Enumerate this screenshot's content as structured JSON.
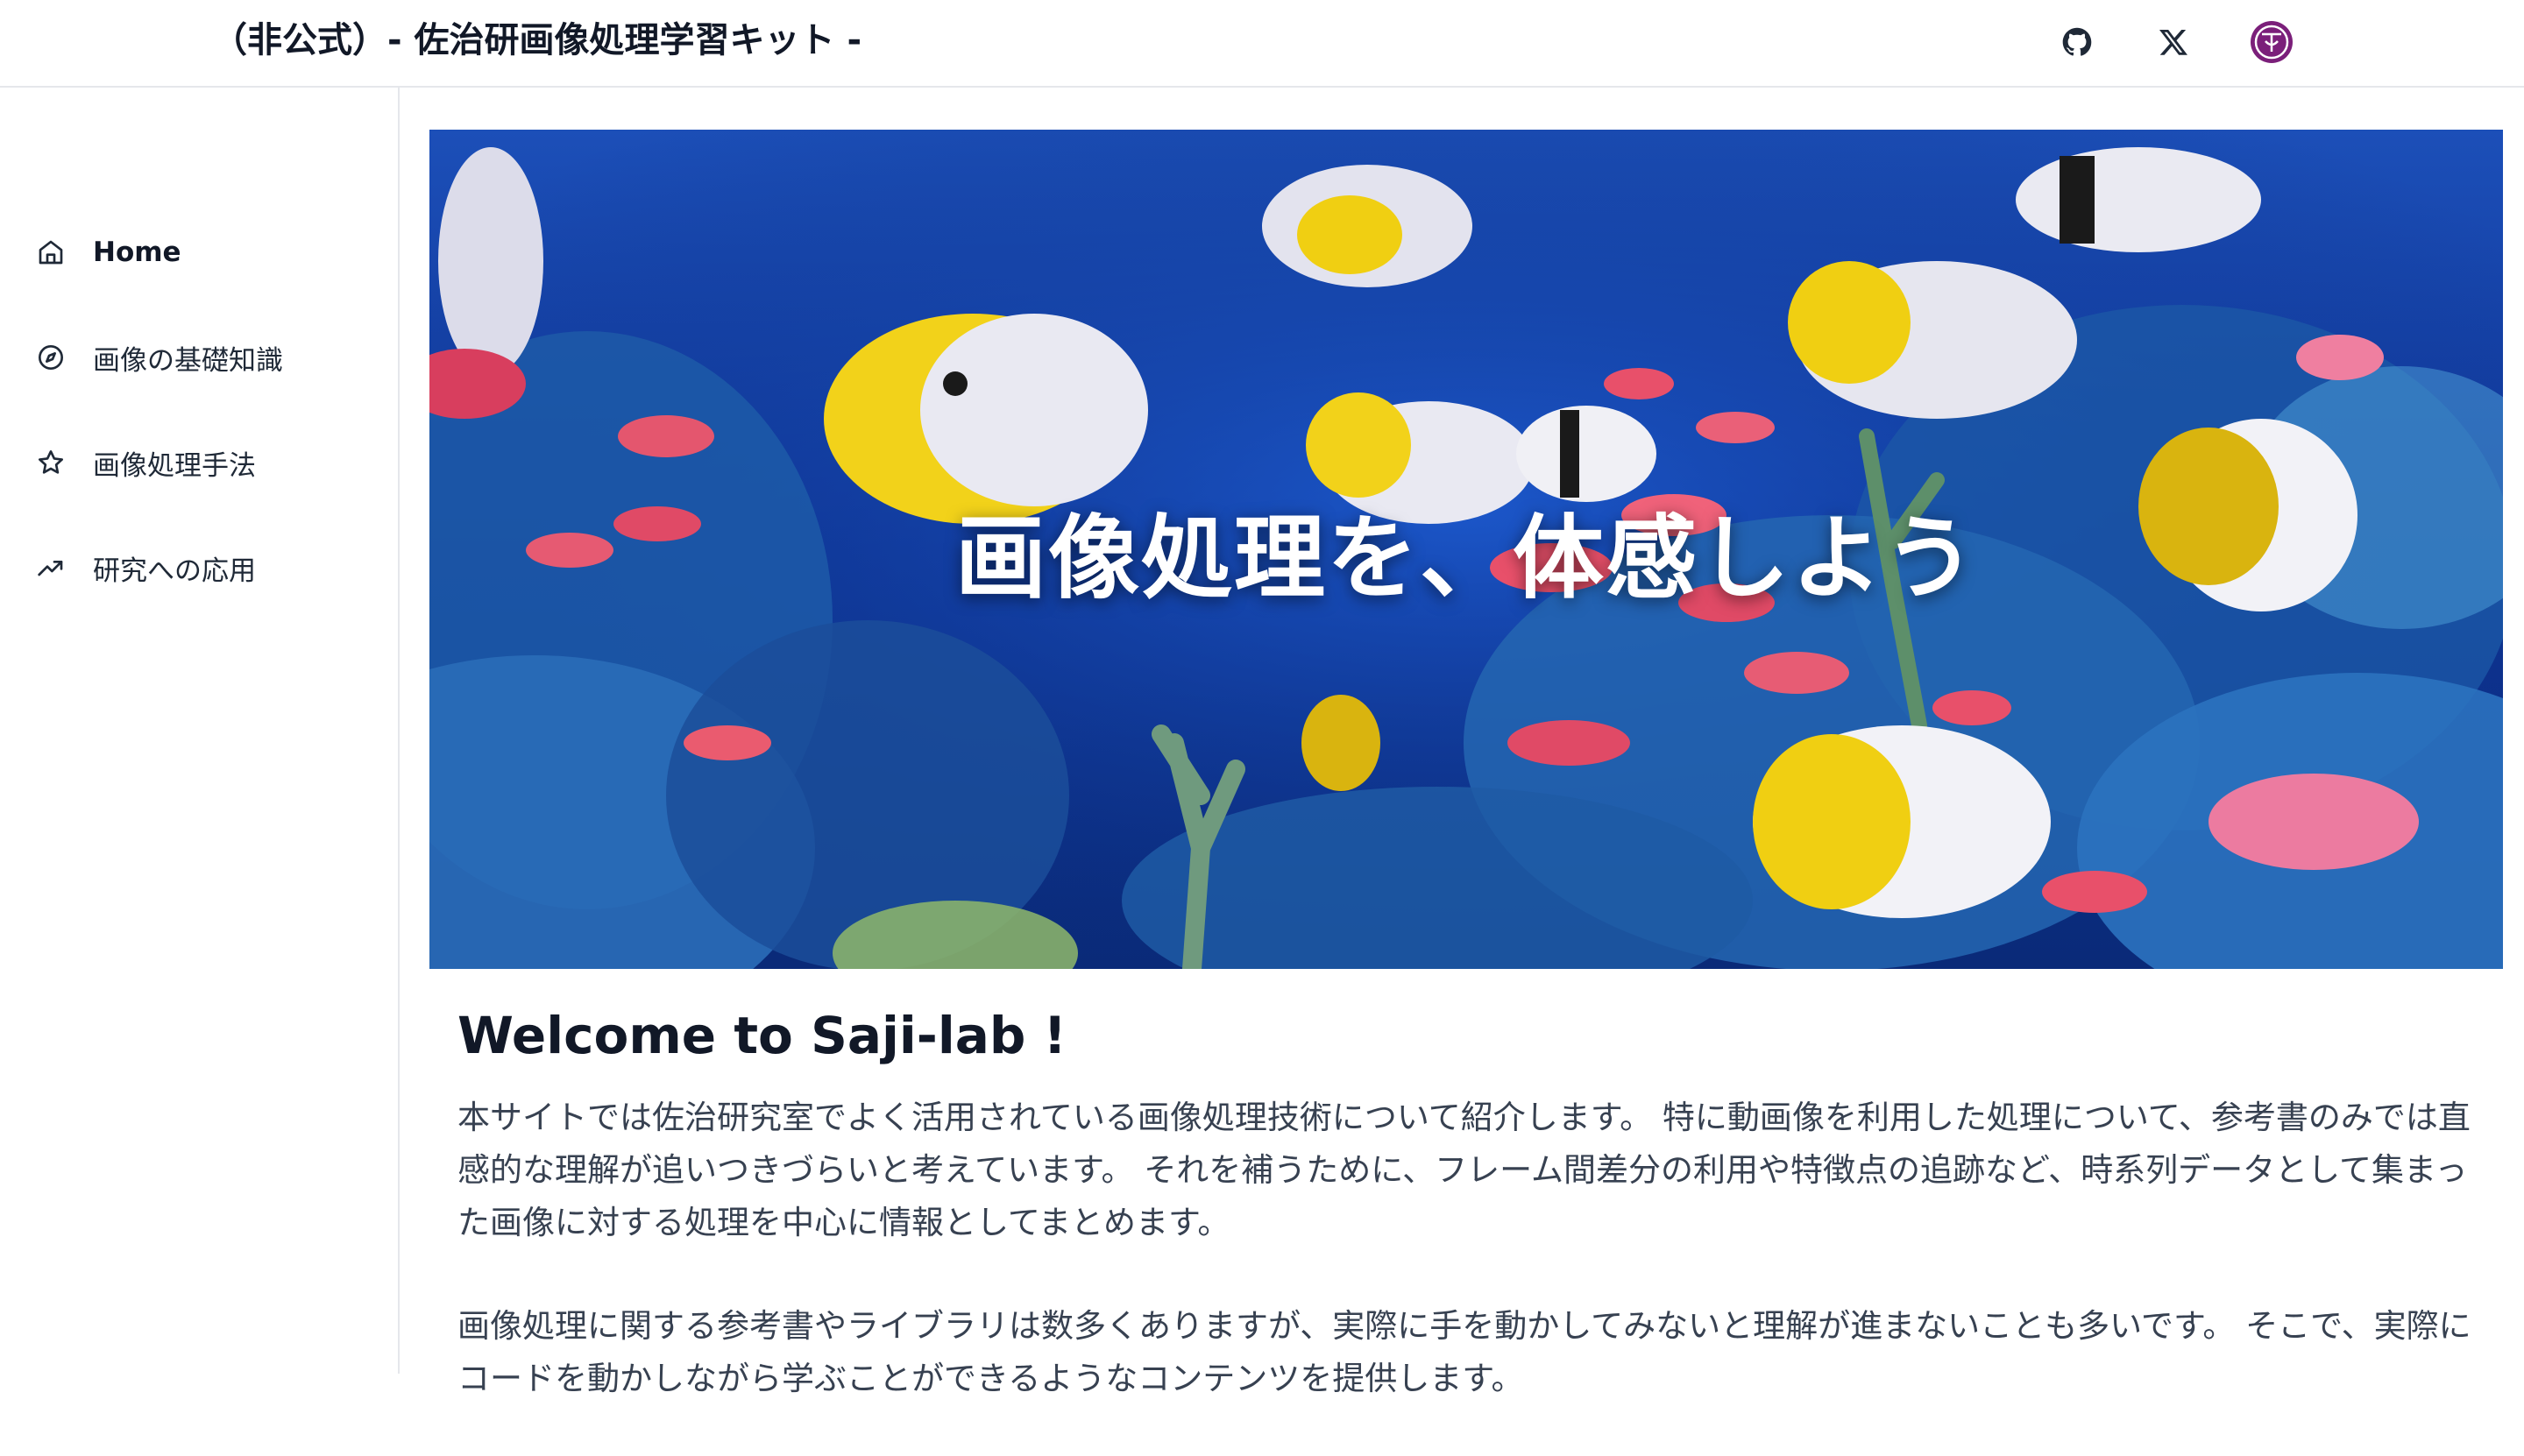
{
  "header": {
    "site_title": "（非公式）- 佐治研画像処理学習キット -",
    "icons": [
      "github-icon",
      "x-icon",
      "lab-logo-icon"
    ]
  },
  "sidebar": {
    "items": [
      {
        "label": "Home",
        "icon": "home-icon",
        "active": true
      },
      {
        "label": "画像の基礎知識",
        "icon": "compass-icon",
        "active": false
      },
      {
        "label": "画像処理手法",
        "icon": "star-icon",
        "active": false
      },
      {
        "label": "研究への応用",
        "icon": "trending-up-icon",
        "active": false
      }
    ]
  },
  "hero": {
    "title": "画像処理を、体感しよう"
  },
  "main": {
    "heading": "Welcome to Saji-lab !",
    "paragraphs": [
      "本サイトでは佐治研究室でよく活用されている画像処理技術について紹介します。 特に動画像を利用した処理について、参考書のみでは直感的な理解が追いつきづらいと考えています。 それを補うために、フレーム間差分の利用や特徴点の追跡など、時系列データとして集まった画像に対する処理を中心に情報としてまとめます。",
      "画像処理に関する参考書やライブラリは数多くありますが、実際に手を動かしてみないと理解が進まないことも多いです。 そこで、実際にコードを動かしながら学ぶことができるようなコンテンツを提供します。"
    ]
  },
  "colors": {
    "accent_logo": "#7b1f7a",
    "hero_water": "#0d2f8a"
  }
}
